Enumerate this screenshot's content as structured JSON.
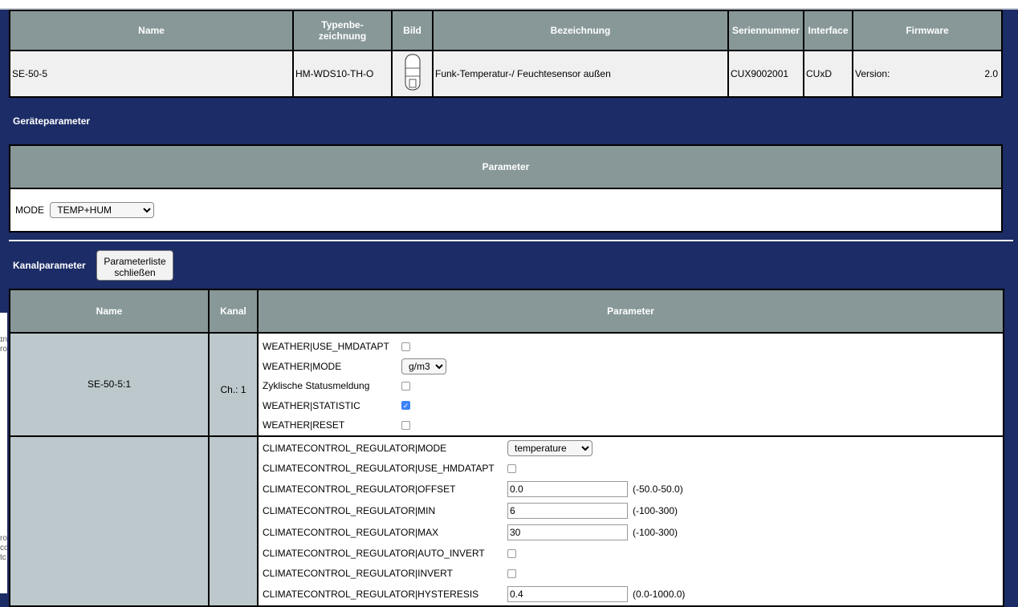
{
  "device_table": {
    "headers": [
      "Name",
      "Typenbe-\nzeichnung",
      "Bild",
      "Bezeichnung",
      "Seriennummer",
      "Interface",
      "Firmware"
    ],
    "row": {
      "name": "SE-50-5",
      "type": "HM-WDS10-TH-O",
      "description": "Funk-Temperatur-/ Feuchtesensor außen",
      "serial": "CUX9002001",
      "interface": "CUxD",
      "firmware_label": "Version:",
      "firmware_value": "2.0"
    }
  },
  "device_params": {
    "title": "Geräteparameter",
    "header": "Parameter",
    "mode_label": "MODE",
    "mode_value": "TEMP+HUM"
  },
  "channel_params": {
    "title": "Kanalparameter",
    "close_button": "Parameterliste schließen",
    "headers": [
      "Name",
      "Kanal",
      "Parameter"
    ],
    "channel1": {
      "name": "SE-50-5:1",
      "kanal": "Ch.: 1",
      "params": [
        {
          "label": "WEATHER|USE_HMDATAPT",
          "type": "checkbox",
          "checked": false
        },
        {
          "label": "WEATHER|MODE",
          "type": "select",
          "value": "g/m3"
        },
        {
          "label": "Zyklische Statusmeldung",
          "type": "checkbox",
          "checked": false
        },
        {
          "label": "WEATHER|STATISTIC",
          "type": "checkbox",
          "checked": true
        },
        {
          "label": "WEATHER|RESET",
          "type": "checkbox",
          "checked": false
        }
      ]
    },
    "channel2": {
      "params": [
        {
          "label": "CLIMATECONTROL_REGULATOR|MODE",
          "type": "select",
          "value": "temperature"
        },
        {
          "label": "CLIMATECONTROL_REGULATOR|USE_HMDATAPT",
          "type": "checkbox",
          "checked": false
        },
        {
          "label": "CLIMATECONTROL_REGULATOR|OFFSET",
          "type": "text",
          "value": "0.0",
          "range": "(-50.0-50.0)"
        },
        {
          "label": "CLIMATECONTROL_REGULATOR|MIN",
          "type": "text",
          "value": "6",
          "range": "(-100-300)"
        },
        {
          "label": "CLIMATECONTROL_REGULATOR|MAX",
          "type": "text",
          "value": "30",
          "range": "(-100-300)"
        },
        {
          "label": "CLIMATECONTROL_REGULATOR|AUTO_INVERT",
          "type": "checkbox",
          "checked": false
        },
        {
          "label": "CLIMATECONTROL_REGULATOR|INVERT",
          "type": "checkbox",
          "checked": false
        },
        {
          "label": "CLIMATECONTROL_REGULATOR|HYSTERESIS",
          "type": "text",
          "value": "0.4",
          "range": "(0.0-1000.0)"
        }
      ]
    }
  },
  "colors": {
    "background": "#1c2c66",
    "header": "#889899",
    "name_cell": "#bcc8cc"
  }
}
